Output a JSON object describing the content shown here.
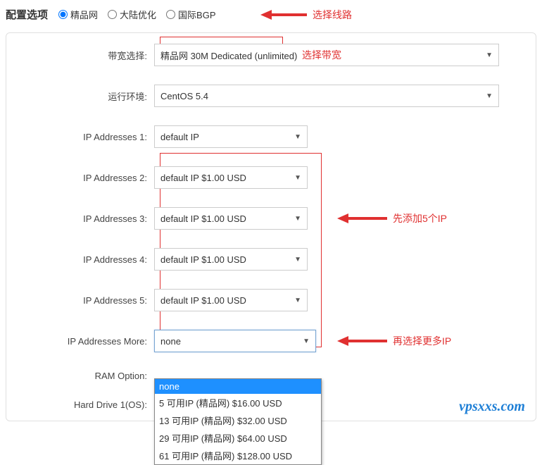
{
  "header": {
    "title": "配置选项",
    "radios": [
      {
        "label": "精品网",
        "checked": true
      },
      {
        "label": "大陆优化",
        "checked": false
      },
      {
        "label": "国际BGP",
        "checked": false
      }
    ]
  },
  "annotations": {
    "line": "选择线路",
    "bandwidth": "选择带宽",
    "addips": "先添加5个IP",
    "moreips": "再选择更多IP"
  },
  "rows": {
    "bandwidth": {
      "label": "带宽选择:",
      "value": "精品网 30M Dedicated (unlimited)"
    },
    "os": {
      "label": "运行环境:",
      "value": "CentOS 5.4"
    },
    "ip1": {
      "label": "IP Addresses 1:",
      "value": "default IP"
    },
    "ip2": {
      "label": "IP Addresses 2:",
      "value": "default IP $1.00 USD"
    },
    "ip3": {
      "label": "IP Addresses 3:",
      "value": "default IP $1.00 USD"
    },
    "ip4": {
      "label": "IP Addresses 4:",
      "value": "default IP $1.00 USD"
    },
    "ip5": {
      "label": "IP Addresses 5:",
      "value": "default IP $1.00 USD"
    },
    "ipmore": {
      "label": "IP Addresses More:",
      "value": "none"
    },
    "ram": {
      "label": "RAM Option:",
      "value": ""
    },
    "hdd": {
      "label": "Hard Drive 1(OS):",
      "value": ""
    }
  },
  "dropdown": {
    "options": [
      "none",
      "5 可用IP (精品网) $16.00 USD",
      "13 可用IP (精品网) $32.00 USD",
      "29 可用IP (精品网) $64.00 USD",
      "61 可用IP (精品网) $128.00 USD"
    ]
  },
  "watermark": "vpsxxs.com"
}
